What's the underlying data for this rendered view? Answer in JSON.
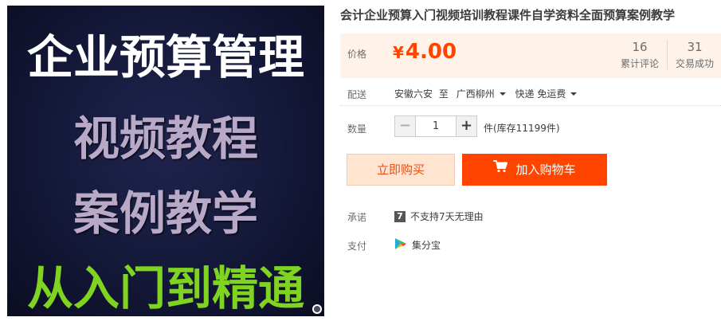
{
  "product": {
    "image_lines": [
      "企业预算管理",
      "视频教程",
      "案例教学",
      "从入门到精通"
    ],
    "title": "会计企业预算入门视频培训教程课件自学资料全面预算案例教学"
  },
  "price": {
    "label": "价格",
    "currency": "¥",
    "amount": "4.00",
    "reviews_count": "16",
    "reviews_label": "累计评论",
    "deals_count": "31",
    "deals_label": "交易成功"
  },
  "shipping": {
    "label": "配送",
    "from": "安徽六安",
    "to_word": "至",
    "to": "广西柳州",
    "method": "快递 免运费"
  },
  "quantity": {
    "label": "数量",
    "minus": "−",
    "value": "1",
    "plus": "+",
    "stock": "件(库存11199件)"
  },
  "actions": {
    "buy_now": "立即购买",
    "add_to_cart": "加入购物车"
  },
  "promise": {
    "label": "承诺",
    "badge": "7",
    "text": "不支持7天无理由"
  },
  "payment": {
    "label": "支付",
    "method": "集分宝"
  },
  "colors": {
    "accent": "#ff4400",
    "price_panel_bg": "#fff2e8",
    "buy_now_bg": "#ffe4d0"
  }
}
